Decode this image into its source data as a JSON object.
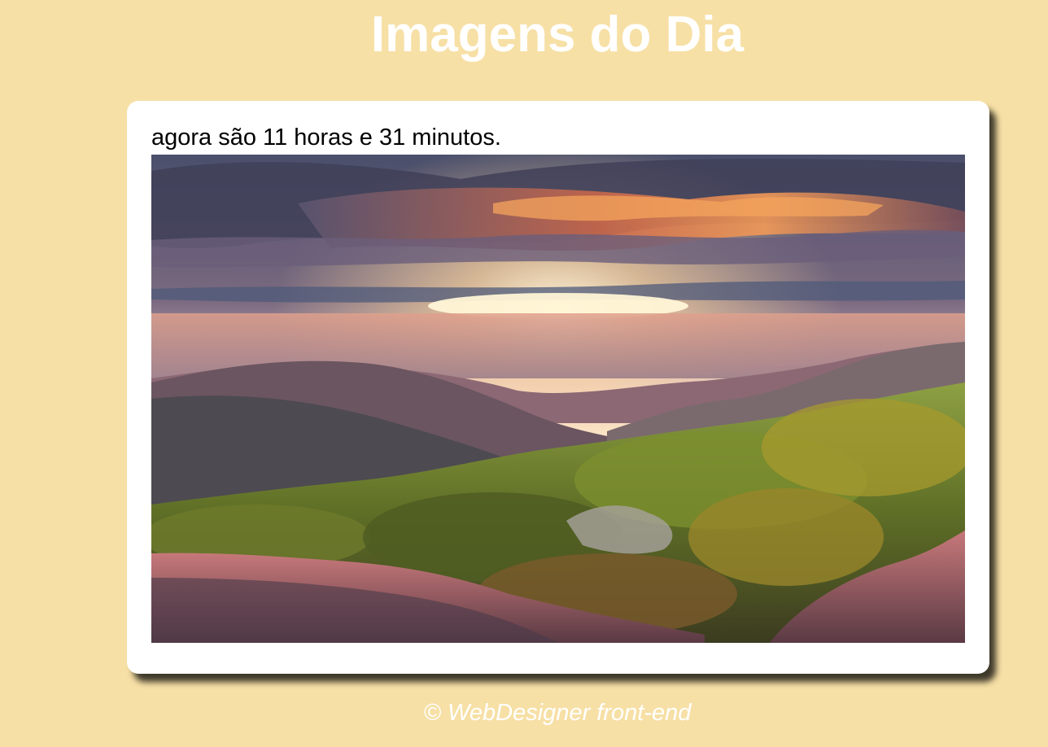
{
  "header": {
    "title": "Imagens do Dia"
  },
  "card": {
    "time_text": "agora são 11 horas e 31 minutos.",
    "image_subject": "mountain-sunset-landscape"
  },
  "footer": {
    "text": "© WebDesigner front-end"
  },
  "colors": {
    "background": "#f7e0a6",
    "title": "#ffffff",
    "card": "#ffffff",
    "footer_text": "#ffffff"
  }
}
